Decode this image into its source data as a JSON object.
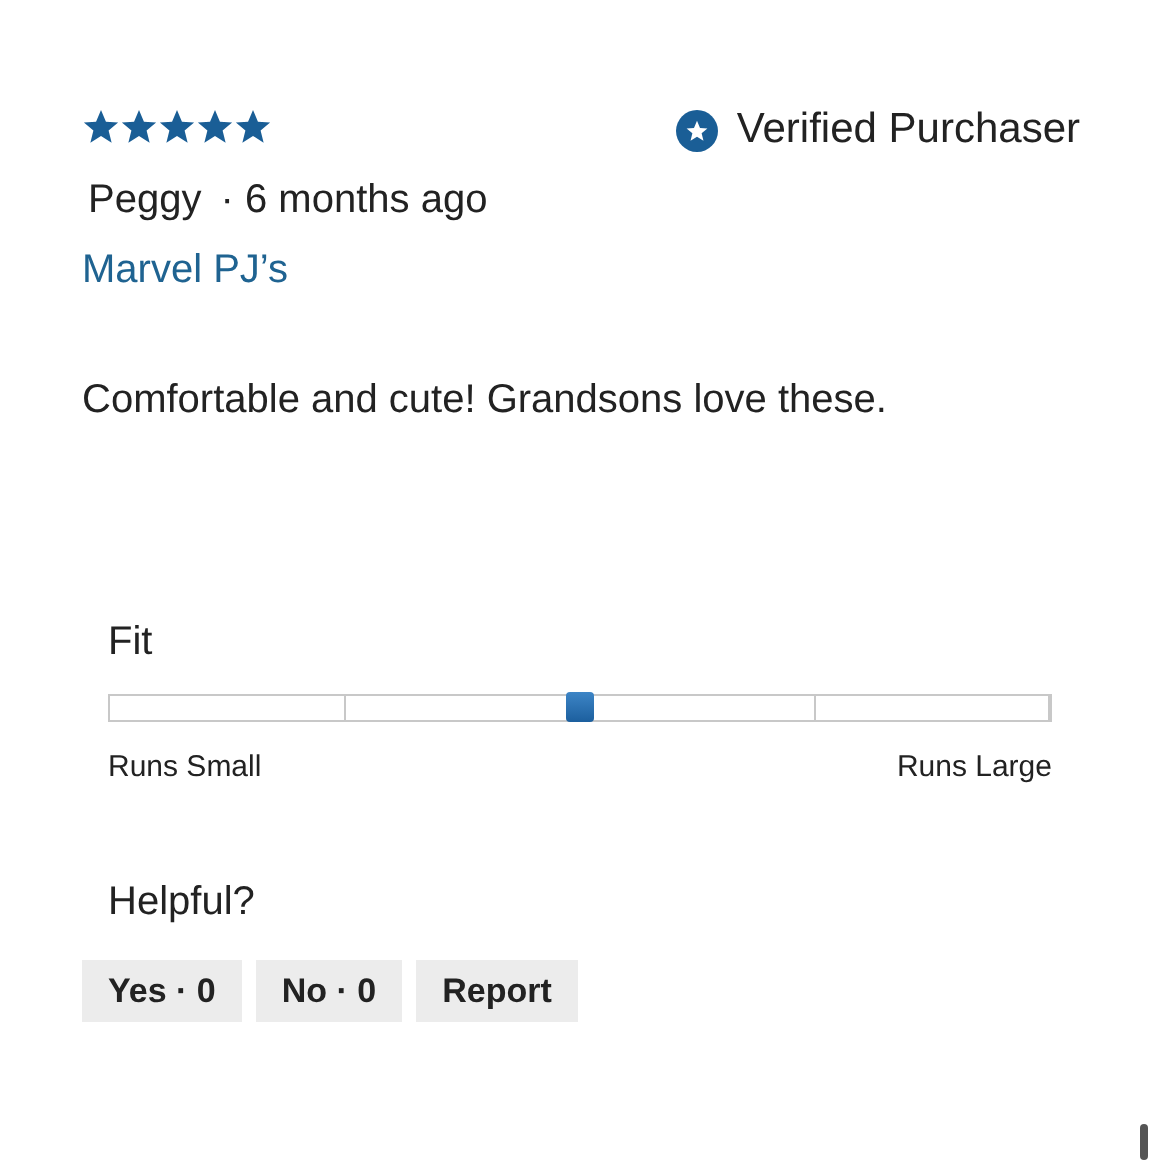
{
  "review": {
    "stars": 5,
    "verified": {
      "label": "Verified Purchaser"
    },
    "author": "Peggy",
    "date": "· 6 months ago",
    "title": "Marvel PJ’s",
    "body": "Comfortable and cute! Grandsons love these."
  },
  "fit": {
    "label": "Fit",
    "level": 0.5,
    "min_label": "Runs Small",
    "max_label": "Runs Large"
  },
  "helpful": {
    "label": "Helpful?",
    "buttons": [
      "Yes · 0",
      "No · 0",
      "Report"
    ]
  }
}
